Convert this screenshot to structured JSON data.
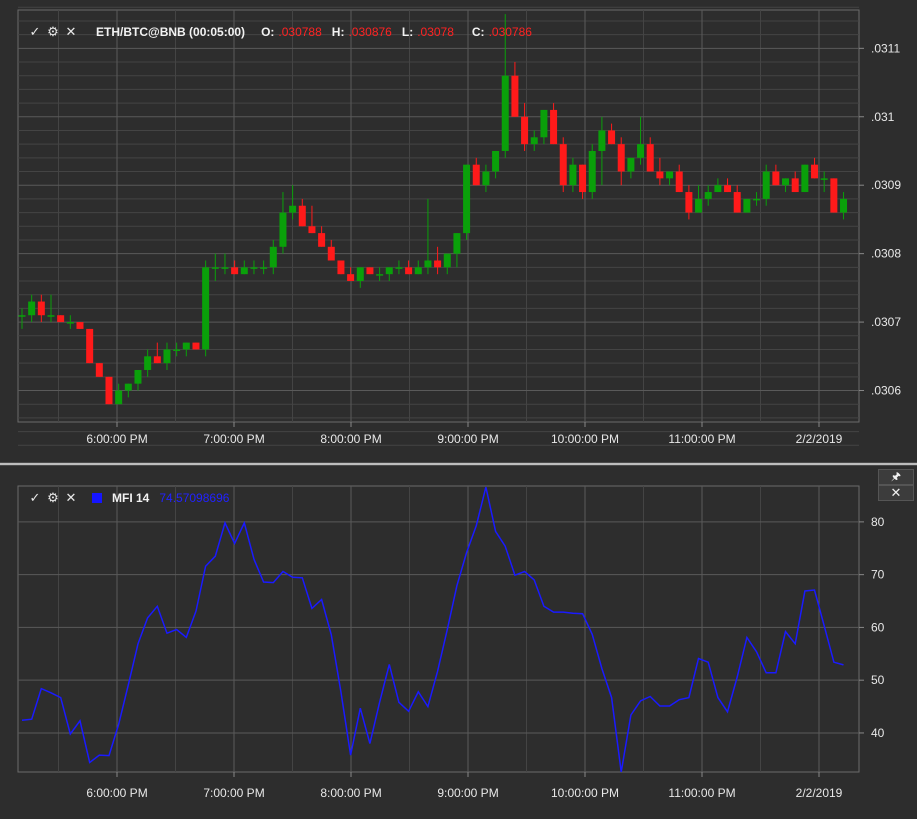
{
  "price_pane": {
    "symbol": "ETH/BTC@BNB (00:05:00)",
    "open_label": "O:",
    "open_value": ".030788",
    "high_label": "H:",
    "high_value": ".030876",
    "low_label": "L:",
    "low_value": ".03078",
    "close_label": "C:",
    "close_value": ".030786"
  },
  "mfi_pane": {
    "label": "MFI 14",
    "value": "74.57098696",
    "line_color": "#1a1aff"
  },
  "controls": {
    "check": "✓",
    "gear": "⚙",
    "close": "✕",
    "pin": "🖈",
    "pane_close": "✕"
  },
  "colors": {
    "up": "#0aa00a",
    "down": "#ff1a1a",
    "grid": "#5a5a5a",
    "axis_text": "#e8e8e8",
    "background": "#2d2d2d"
  },
  "chart_data": [
    {
      "type": "candlestick",
      "x_tick_labels": [
        "6:00:00 PM",
        "7:00:00 PM",
        "8:00:00 PM",
        "9:00:00 PM",
        "10:00:00 PM",
        "11:00:00 PM",
        "2/2/2019"
      ],
      "y_tick_labels": [
        ".0306",
        ".0307",
        ".0308",
        ".0309",
        ".031",
        ".0311"
      ],
      "ylim": [
        0.030554,
        0.031156
      ],
      "grid": true,
      "candles": [
        [
          0.03071,
          0.03072,
          0.03069,
          0.03071
        ],
        [
          0.03071,
          0.03074,
          0.0307,
          0.03073
        ],
        [
          0.03073,
          0.03074,
          0.0307,
          0.03071
        ],
        [
          0.03071,
          0.03074,
          0.0307,
          0.03071
        ],
        [
          0.03071,
          0.03071,
          0.0307,
          0.0307
        ],
        [
          0.0307,
          0.03071,
          0.03069,
          0.0307
        ],
        [
          0.0307,
          0.0307,
          0.03069,
          0.03069
        ],
        [
          0.03069,
          0.03069,
          0.03064,
          0.03064
        ],
        [
          0.03064,
          0.03064,
          0.03062,
          0.03062
        ],
        [
          0.03062,
          0.03062,
          0.03058,
          0.03058
        ],
        [
          0.03058,
          0.03061,
          0.03058,
          0.0306
        ],
        [
          0.0306,
          0.03061,
          0.03059,
          0.03061
        ],
        [
          0.03061,
          0.03063,
          0.0306,
          0.03063
        ],
        [
          0.03063,
          0.03066,
          0.03062,
          0.03065
        ],
        [
          0.03065,
          0.03067,
          0.03064,
          0.03064
        ],
        [
          0.03064,
          0.03067,
          0.03063,
          0.03066
        ],
        [
          0.03066,
          0.03067,
          0.03065,
          0.03066
        ],
        [
          0.03066,
          0.03067,
          0.03065,
          0.03067
        ],
        [
          0.03067,
          0.03067,
          0.03066,
          0.03066
        ],
        [
          0.03066,
          0.03079,
          0.03065,
          0.03078
        ],
        [
          0.03078,
          0.0308,
          0.03076,
          0.03078
        ],
        [
          0.03078,
          0.0308,
          0.03077,
          0.03078
        ],
        [
          0.03078,
          0.03079,
          0.03077,
          0.03077
        ],
        [
          0.03077,
          0.03079,
          0.03077,
          0.03078
        ],
        [
          0.03078,
          0.03079,
          0.03077,
          0.03078
        ],
        [
          0.03078,
          0.03079,
          0.03077,
          0.03078
        ],
        [
          0.03078,
          0.03082,
          0.03077,
          0.03081
        ],
        [
          0.03081,
          0.03089,
          0.0308,
          0.03086
        ],
        [
          0.03086,
          0.0309,
          0.03085,
          0.03087
        ],
        [
          0.03087,
          0.03088,
          0.03084,
          0.03084
        ],
        [
          0.03084,
          0.03087,
          0.03083,
          0.03083
        ],
        [
          0.03083,
          0.03084,
          0.03081,
          0.03081
        ],
        [
          0.03081,
          0.03082,
          0.03079,
          0.03079
        ],
        [
          0.03079,
          0.03079,
          0.03077,
          0.03077
        ],
        [
          0.03077,
          0.03078,
          0.03076,
          0.03076
        ],
        [
          0.03076,
          0.03078,
          0.03075,
          0.03078
        ],
        [
          0.03078,
          0.03078,
          0.03077,
          0.03077
        ],
        [
          0.03077,
          0.03078,
          0.03076,
          0.03077
        ],
        [
          0.03077,
          0.03078,
          0.03076,
          0.03078
        ],
        [
          0.03078,
          0.03079,
          0.03077,
          0.03078
        ],
        [
          0.03078,
          0.03079,
          0.03077,
          0.03077
        ],
        [
          0.03077,
          0.03079,
          0.03077,
          0.03078
        ],
        [
          0.03078,
          0.03088,
          0.03077,
          0.03079
        ],
        [
          0.03079,
          0.03081,
          0.03077,
          0.03078
        ],
        [
          0.03078,
          0.0308,
          0.03077,
          0.0308
        ],
        [
          0.0308,
          0.03083,
          0.03078,
          0.03083
        ],
        [
          0.03083,
          0.03093,
          0.03082,
          0.03093
        ],
        [
          0.03093,
          0.03094,
          0.0309,
          0.0309
        ],
        [
          0.0309,
          0.03093,
          0.03089,
          0.03092
        ],
        [
          0.03092,
          0.03095,
          0.03091,
          0.03095
        ],
        [
          0.03095,
          0.03115,
          0.03094,
          0.03106
        ],
        [
          0.03106,
          0.03108,
          0.031,
          0.031
        ],
        [
          0.031,
          0.03102,
          0.03095,
          0.03096
        ],
        [
          0.03096,
          0.03098,
          0.03095,
          0.03097
        ],
        [
          0.03097,
          0.03101,
          0.03096,
          0.03101
        ],
        [
          0.03101,
          0.03102,
          0.03096,
          0.03096
        ],
        [
          0.03096,
          0.03097,
          0.03089,
          0.0309
        ],
        [
          0.0309,
          0.03094,
          0.03089,
          0.03093
        ],
        [
          0.03093,
          0.03093,
          0.03088,
          0.03089
        ],
        [
          0.03089,
          0.03096,
          0.03088,
          0.03095
        ],
        [
          0.03095,
          0.031,
          0.0309,
          0.03098
        ],
        [
          0.03098,
          0.03099,
          0.03096,
          0.03096
        ],
        [
          0.03096,
          0.03097,
          0.0309,
          0.03092
        ],
        [
          0.03092,
          0.03094,
          0.03091,
          0.03094
        ],
        [
          0.03094,
          0.031,
          0.03093,
          0.03096
        ],
        [
          0.03096,
          0.03097,
          0.03092,
          0.03092
        ],
        [
          0.03092,
          0.03094,
          0.0309,
          0.03091
        ],
        [
          0.03091,
          0.03092,
          0.0309,
          0.03092
        ],
        [
          0.03092,
          0.03093,
          0.03089,
          0.03089
        ],
        [
          0.03089,
          0.0309,
          0.03085,
          0.03086
        ],
        [
          0.03086,
          0.0309,
          0.03086,
          0.03088
        ],
        [
          0.03088,
          0.0309,
          0.03087,
          0.03089
        ],
        [
          0.03089,
          0.03091,
          0.03089,
          0.0309
        ],
        [
          0.0309,
          0.03091,
          0.03089,
          0.03089
        ],
        [
          0.03089,
          0.0309,
          0.03086,
          0.03086
        ],
        [
          0.03086,
          0.03088,
          0.03086,
          0.03088
        ],
        [
          0.03088,
          0.03089,
          0.03087,
          0.03088
        ],
        [
          0.03088,
          0.03093,
          0.03087,
          0.03092
        ],
        [
          0.03092,
          0.03093,
          0.0309,
          0.0309
        ],
        [
          0.0309,
          0.03091,
          0.03089,
          0.03091
        ],
        [
          0.03091,
          0.03092,
          0.03089,
          0.03089
        ],
        [
          0.03089,
          0.03093,
          0.03089,
          0.03093
        ],
        [
          0.03093,
          0.03094,
          0.03091,
          0.03091
        ],
        [
          0.03091,
          0.03092,
          0.03089,
          0.03091
        ],
        [
          0.03091,
          0.03091,
          0.03086,
          0.03086
        ],
        [
          0.03086,
          0.03089,
          0.03085,
          0.03088
        ]
      ]
    },
    {
      "type": "line",
      "x_tick_labels": [
        "6:00:00 PM",
        "7:00:00 PM",
        "8:00:00 PM",
        "9:00:00 PM",
        "10:00:00 PM",
        "11:00:00 PM",
        "2/2/2019"
      ],
      "y_tick_labels": [
        "40",
        "50",
        "60",
        "70",
        "80"
      ],
      "ylim": [
        32.6,
        86.8
      ],
      "grid": true,
      "values": [
        42.4,
        42.6,
        48.4,
        47.6,
        46.7,
        39.8,
        42.3,
        34.4,
        35.8,
        35.7,
        41.6,
        49.1,
        56.9,
        61.8,
        64.0,
        58.9,
        59.6,
        58.1,
        63.1,
        71.6,
        73.5,
        79.8,
        75.9,
        79.8,
        72.9,
        68.6,
        68.5,
        70.6,
        69.5,
        69.4,
        63.6,
        65.3,
        58.6,
        47.8,
        35.8,
        44.7,
        38.0,
        45.8,
        53.0,
        45.8,
        44.1,
        47.8,
        45.0,
        51.7,
        59.6,
        67.9,
        74.2,
        79.3,
        86.6,
        78.2,
        75.4,
        69.9,
        70.6,
        69.0,
        64.0,
        62.9,
        62.9,
        62.7,
        62.6,
        58.7,
        52.2,
        46.7,
        32.6,
        43.4,
        46.1,
        46.9,
        45.1,
        45.1,
        46.3,
        46.7,
        54.1,
        53.4,
        46.7,
        44.0,
        50.6,
        58.1,
        55.4,
        51.4,
        51.4,
        59.2,
        56.9,
        66.9,
        67.1,
        60.3,
        53.4,
        52.9
      ]
    }
  ]
}
